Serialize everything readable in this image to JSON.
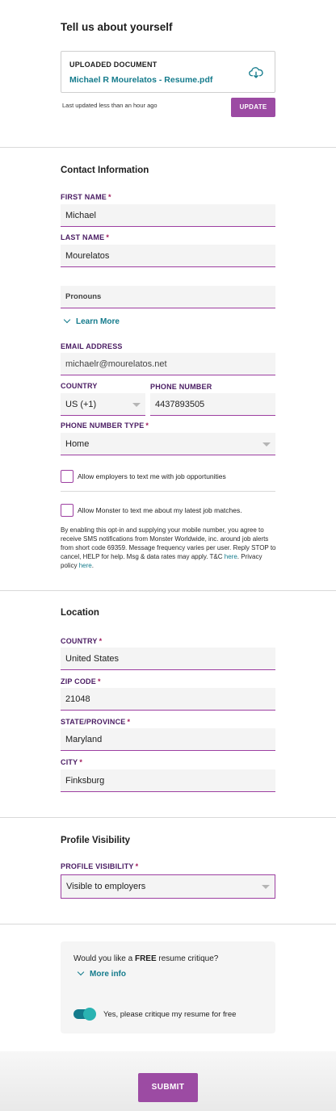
{
  "header": {
    "title": "Tell us about yourself"
  },
  "upload": {
    "heading": "UPLOADED DOCUMENT",
    "filename": "Michael R Mourelatos - Resume.pdf",
    "icon": "cloud-download-icon",
    "last_updated": "Last updated less than an hour ago",
    "update_label": "UPDATE"
  },
  "contact": {
    "title": "Contact Information",
    "first_name_label": "FIRST NAME",
    "first_name": "Michael",
    "last_name_label": "LAST NAME",
    "last_name": "Mourelatos",
    "pronouns_placeholder": "Pronouns",
    "learn_more": "Learn More",
    "email_label": "EMAIL ADDRESS",
    "email": "michaelr@mourelatos.net",
    "country_label": "COUNTRY",
    "country": "US (+1)",
    "phone_label": "PHONE NUMBER",
    "phone": "4437893505",
    "phone_type_label": "PHONE NUMBER TYPE",
    "phone_type": "Home",
    "allow_employers_text": "Allow employers to text me with job opportunities",
    "allow_monster_text": "Allow Monster to text me about my latest job matches.",
    "disclaimer_main": "By enabling this opt-in and supplying your mobile number, you agree to receive SMS notifications from Monster Worldwide, inc. around job alerts from short code 69359. Message frequency varies per user. Reply STOP to cancel, HELP for help. Msg & data rates may apply. T&C ",
    "disclaimer_here1": "here",
    "disclaimer_mid": ". Privacy policy ",
    "disclaimer_here2": "here",
    "disclaimer_end": "."
  },
  "location": {
    "title": "Location",
    "country_label": "COUNTRY",
    "country": "United States",
    "zip_label": "ZIP CODE",
    "zip": "21048",
    "state_label": "STATE/PROVINCE",
    "state": "Maryland",
    "city_label": "CITY",
    "city": "Finksburg"
  },
  "visibility": {
    "title": "Profile Visibility",
    "label": "PROFILE VISIBILITY",
    "value": "Visible to employers"
  },
  "critique": {
    "question_pre": "Would you like a ",
    "question_bold": "FREE",
    "question_post": " resume critique?",
    "more_info": "More info",
    "toggle_label": "Yes, please critique my resume for free",
    "toggle_on": true
  },
  "footer": {
    "submit_label": "SUBMIT"
  },
  "colors": {
    "accent": "#9c4ba3",
    "link": "#147b8c",
    "label": "#4a1c63",
    "required": "#a2195b"
  },
  "required_marker": "*"
}
